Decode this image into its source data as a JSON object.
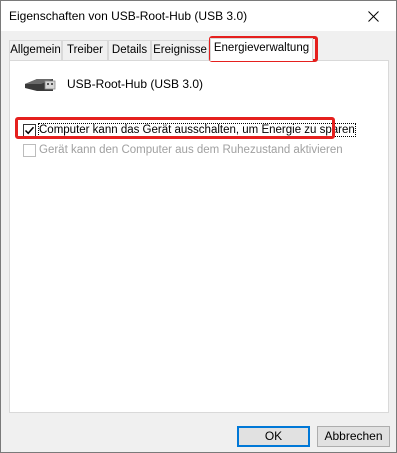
{
  "window": {
    "title": "Eigenschaften von USB-Root-Hub (USB 3.0)",
    "close_icon": "close-icon"
  },
  "tabs": [
    {
      "label": "Allgemein",
      "active": false
    },
    {
      "label": "Treiber",
      "active": false
    },
    {
      "label": "Details",
      "active": false
    },
    {
      "label": "Ereignisse",
      "active": false
    },
    {
      "label": "Energieverwaltung",
      "active": true
    }
  ],
  "device": {
    "icon": "usb-plug-icon",
    "name": "USB-Root-Hub (USB 3.0)"
  },
  "options": [
    {
      "label": "Computer kann das Gerät ausschalten, um Energie zu sparen",
      "checked": true,
      "enabled": true
    },
    {
      "label": "Gerät kann den Computer aus dem Ruhezustand aktivieren",
      "checked": false,
      "enabled": false
    }
  ],
  "buttons": {
    "ok": "OK",
    "cancel": "Abbrechen"
  },
  "colors": {
    "highlight": "#e5201e",
    "focus_border": "#0078d7"
  }
}
